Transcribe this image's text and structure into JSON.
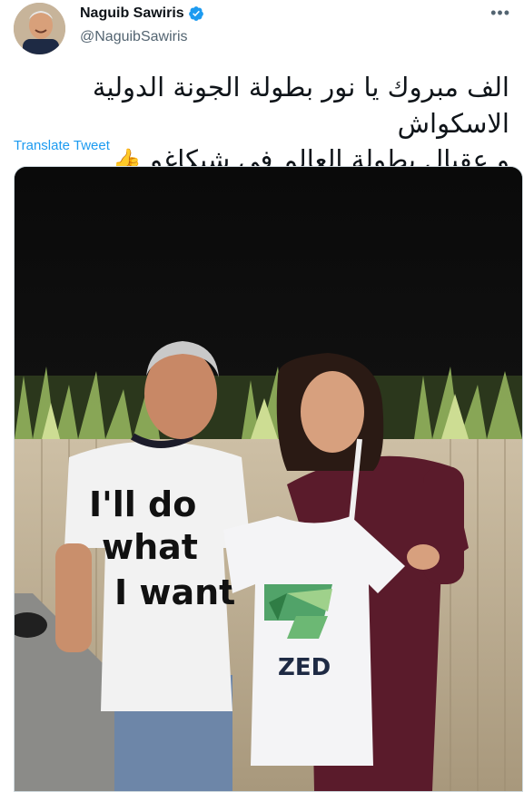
{
  "author": {
    "name": "Naguib Sawiris",
    "handle": "@NaguibSawiris",
    "verified_icon": "verified-badge-icon",
    "avatar_icon": "avatar"
  },
  "more_icon": "more-options-icon",
  "tweet": {
    "line1": "الف مبروك يا نور بطولة الجونة الدولية الاسكواش",
    "line2": "و عقبال بطولة العالم فى شيكاغو",
    "emoji": "👍"
  },
  "translate_label": "Translate Tweet",
  "media": {
    "shirt_left_text": "I'll do what I want",
    "shirt_right_brand": "ZED"
  },
  "colors": {
    "link": "#1d9bf0",
    "secondary_text": "#536471",
    "verified": "#1d9bf0",
    "dress": "#5a1b2b",
    "logo_green": "#3f9a5a"
  }
}
